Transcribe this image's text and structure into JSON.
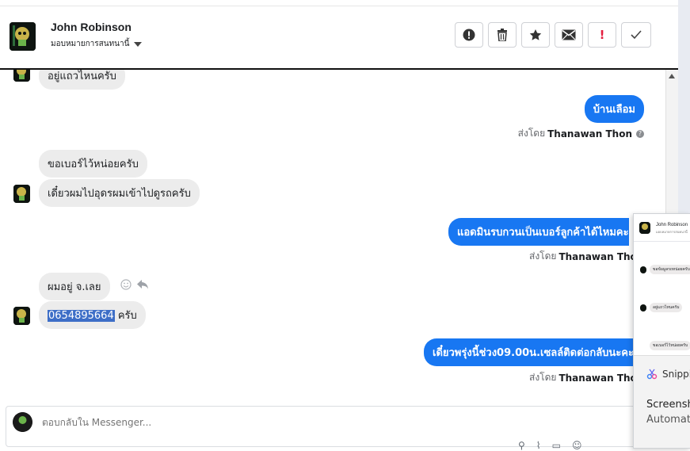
{
  "header": {
    "contact_name": "John Robinson",
    "assign_label": "มอบหมายการสนทนานี้"
  },
  "actions": [
    {
      "name": "spam-button",
      "glyph": "!"
    },
    {
      "name": "delete-button",
      "glyph": ""
    },
    {
      "name": "star-button",
      "glyph": ""
    },
    {
      "name": "mark-unread-button",
      "glyph": ""
    },
    {
      "name": "follow-up-button",
      "glyph": "!"
    },
    {
      "name": "done-button",
      "glyph": ""
    }
  ],
  "thread": {
    "partial_top_message": "อยู่แถวไหนครับ",
    "messages": [
      {
        "side": "out",
        "text": "บ้านเลือม"
      },
      {
        "side": "in",
        "text": "ขอเบอร์ไว้หน่อยครับ"
      },
      {
        "side": "in",
        "text": "เดี๋ยวผมไปอุดรผมเข้าไปดูรถครับ"
      },
      {
        "side": "out",
        "text": "แอดมินรบกวนเป็นเบอร์ลูกค้าได้ไหมคะ"
      },
      {
        "side": "in",
        "text": "ผมอยู่ จ.เลย"
      },
      {
        "side": "in",
        "text_selected": "0654895664",
        "text_rest": " ครับ"
      },
      {
        "side": "out",
        "text": "เดี๋ยวพรุ่งนี้ช่วง09.00น.เซลล์ติดต่อกลับนะคะ"
      }
    ],
    "sent_by_prefix": "ส่งโดย",
    "sent_by_name": "Thanawan Thon"
  },
  "composer": {
    "placeholder": "ตอบกลับใน Messenger..."
  },
  "popup": {
    "contact_name": "John Robinson",
    "subtitle": "มอบหมายการสนทนานี้",
    "rows": [
      "ขอข้อมูลรถหน่อยครับ",
      "อยู่แถวไหนครับ",
      "ขอเบอร์ไว้หน่อยครับ"
    ],
    "snip_title": "Snipping Tool",
    "snip_line1": "Screenshot copied",
    "snip_line2": "Automatically saved"
  },
  "colors": {
    "accent": "#1877f2",
    "incoming_bubble": "#ececec",
    "selection": "#3d6ec7",
    "follow_up_red": "#e41e3f"
  }
}
